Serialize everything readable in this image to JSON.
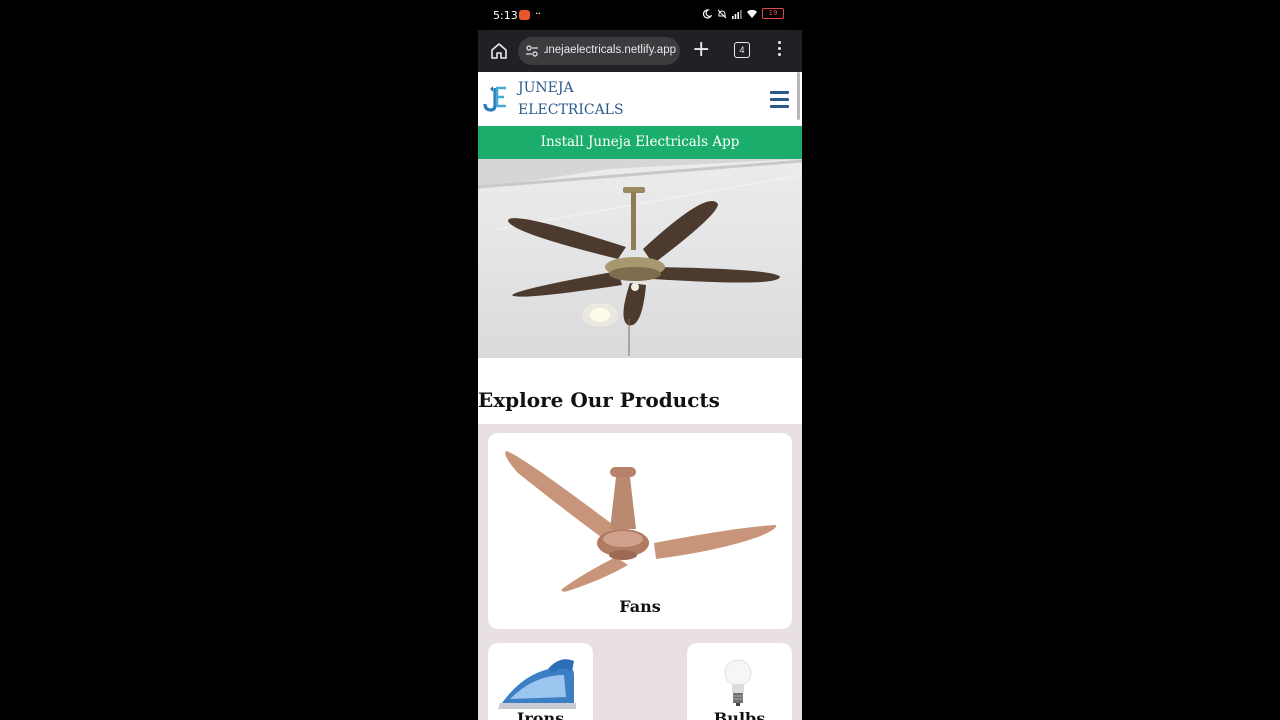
{
  "status_bar": {
    "time": "5:13",
    "battery": "19"
  },
  "browser": {
    "url": "junejaelectricals.netlify.app",
    "tab_count": "4"
  },
  "site": {
    "brand_line1": "JUNEJA",
    "brand_line2": "ELECTRICALS",
    "install_banner": "Install Juneja Electricals App",
    "section_title": "Explore Our Products",
    "products": [
      {
        "label": "Fans"
      },
      {
        "label": "Irons"
      },
      {
        "label": "Bulbs"
      }
    ]
  },
  "colors": {
    "brand_blue": "#2a5a8c",
    "install_green": "#1aad6c",
    "products_bg": "#e7dfe4"
  },
  "icons": [
    "home-icon",
    "site-info-icon",
    "new-tab-icon",
    "tab-switcher-icon",
    "menu-icon",
    "hamburger-icon"
  ]
}
